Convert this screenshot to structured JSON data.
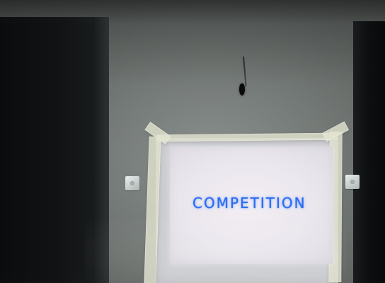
{
  "scene": {
    "projection": {
      "text": "COMPETITION",
      "text_color": "#2c6df2"
    },
    "wall": {
      "color": "#7b817e"
    },
    "icons": {
      "left_switch": "light-switch-icon",
      "right_switch": "light-switch-icon",
      "hook": "hook-icon"
    }
  }
}
